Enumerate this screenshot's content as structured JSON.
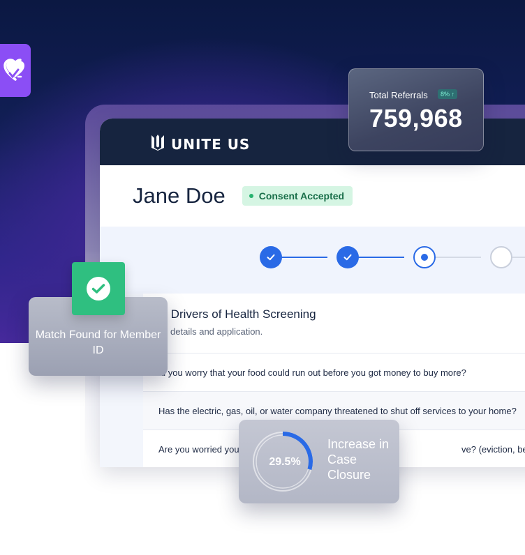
{
  "brand": {
    "name": "UNITE US",
    "accent": "#2a6ae6",
    "header_bg": "#16243f"
  },
  "stats": {
    "referrals_label": "Total Referrals",
    "referrals_change": "8% ↑",
    "referrals_value": "759,968",
    "match_text": "Match Found for Member ID",
    "closure_value": "29.5%",
    "closure_fraction": 0.295,
    "closure_text": "Increase in Case Closure"
  },
  "person": {
    "name": "Jane Doe",
    "status": "Consent Accepted"
  },
  "stepper": {
    "steps": [
      "done",
      "done",
      "active",
      "todo"
    ]
  },
  "section": {
    "title": "ocial Drivers of Health Screening",
    "subtitle": "rsonal details and application."
  },
  "questions": [
    "id you worry that your food could run out before you got money to buy more?",
    "Has the electric, gas, oil, or water company threatened to shut off services to your home?",
    "Are you worried you",
    "ve? (eviction, being kicked out,"
  ],
  "icons": {
    "heart": "heart-check-icon",
    "check": "check-icon",
    "logo": "unite-us-logo-icon"
  }
}
